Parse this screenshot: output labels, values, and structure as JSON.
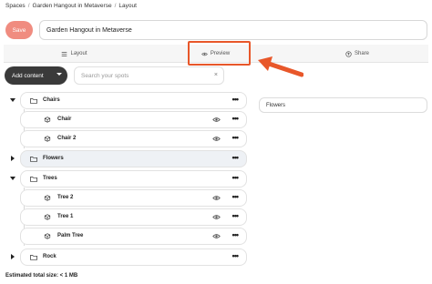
{
  "breadcrumb": [
    "Spaces",
    "Garden Hangout in Metaverse",
    "Layout"
  ],
  "breadcrumb_separator": "/",
  "save_label": "Save",
  "title_value": "Garden Hangout in Metaverse",
  "tabs": {
    "layout": "Layout",
    "preview": "Preview",
    "share": "Share"
  },
  "add_content_label": "Add content",
  "search_placeholder": "Search your spots",
  "search_clear": "×",
  "tree": {
    "chairs": "Chairs",
    "chair": "Chair",
    "chair2": "Chair 2",
    "flowers": "Flowers",
    "trees": "Trees",
    "tree2": "Tree 2",
    "tree1": "Tree 1",
    "palm": "Palm Tree",
    "rock": "Rock"
  },
  "more_label": "•••",
  "selected_field": "Flowers",
  "footer": "Estimated total size: < 1 MB",
  "colors": {
    "save_bg": "#f08c80",
    "highlight": "#e8572a",
    "add_bg": "#3a3a3a"
  }
}
